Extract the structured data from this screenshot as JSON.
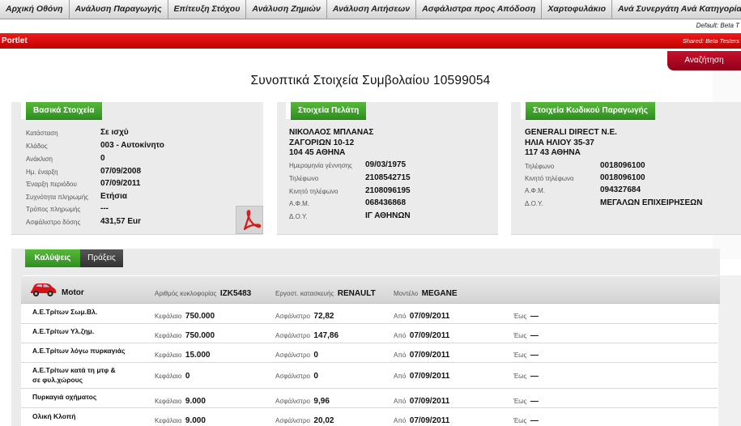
{
  "nav": {
    "tabs": [
      "Αρχική Οθόνη",
      "Ανάλυση Παραγωγής",
      "Επίτευξη Στόχου",
      "Ανάλυση Ζημιών",
      "Ανάλυση Αιτήσεων",
      "Ασφάλιστρα προς Απόδοση",
      "Χαρτοφυλάκιο",
      "Ανά Συνεργάτη Ανά Κατηγορία Προϊό"
    ],
    "default_text": "Default: Beta T"
  },
  "portlet": {
    "title": "Portlet",
    "shared": "Shared: Beta Testers",
    "search_label": "Αναζήτηση"
  },
  "page_title": "Συνοπτικά Στοιχεία Συμβολαίου 10599054",
  "basic": {
    "tab_label": "Βασικά Στοιχεία",
    "rows": [
      {
        "label": "Κατάσταση",
        "value": "Σε ισχύ"
      },
      {
        "label": "Κλάδος",
        "value": "003 - Αυτοκίνητο"
      },
      {
        "label": "Ανάκλιση",
        "value": "0"
      },
      {
        "label": "Ημ. έναρξη",
        "value": "07/09/2008"
      },
      {
        "label": "Έναρξη περιόδου",
        "value": "07/09/2011"
      },
      {
        "label": "Συχνότητα πληρωμής",
        "value": "Ετήσια"
      },
      {
        "label": "Τρόπος πληρωμής",
        "value": "---"
      },
      {
        "label": "Ασφάλιστρο δόσης",
        "value": "431,57 Eur"
      }
    ]
  },
  "client": {
    "tab_label": "Στοιχεία Πελάτη",
    "name": "ΝΙΚΟΛΑΟΣ ΜΠΛΑΝΑΣ",
    "address1": "ΖΑΓΟΡΙΩΝ 10-12",
    "address2": "104 45 ΑΘΗΝΑ",
    "rows": [
      {
        "label": "Ημερομηνία γέννησης",
        "value": "09/03/1975"
      },
      {
        "label": "Τηλέφωνο",
        "value": "2108542715"
      },
      {
        "label": "Κινητό τηλέφωνο",
        "value": "2108096195"
      },
      {
        "label": "Α.Φ.Μ.",
        "value": "068436868"
      },
      {
        "label": "Δ.Ο.Υ.",
        "value": "ΙΓ ΑΘΗΝΩΝ"
      }
    ]
  },
  "producer": {
    "tab_label": "Στοιχεία Κωδικού Παραγωγής",
    "name": "GENERALI DIRECT Ν.Ε.",
    "address1": "ΗΛΙΑ ΗΛΙΟΥ 35-37",
    "address2": "117 43 ΑΘΗΝΑ",
    "rows": [
      {
        "label": "Τηλέφωνο",
        "value": "0018096100"
      },
      {
        "label": "Κινητό τηλέφωνο",
        "value": "0018096100"
      },
      {
        "label": "Α.Φ.Μ.",
        "value": "094327684"
      },
      {
        "label": "Δ.Ο.Υ.",
        "value": "ΜΕΓΑΛΩΝ ΕΠΙΧΕΙΡΗΣΕΩΝ"
      }
    ]
  },
  "coverage": {
    "tabs": {
      "active": "Καλύψεις",
      "inactive": "Πράξεις"
    },
    "motor": {
      "title": "Motor",
      "plate_label": "Αριθμός κυκλοφορίας",
      "plate": "IZK5483",
      "maker_label": "Εργοστ. κατασκευής",
      "maker": "RENAULT",
      "model_label": "Μοντέλο",
      "model": "MEGANE"
    },
    "labels": {
      "capital": "Κεφάλαιο",
      "premium": "Ασφάλιστρο",
      "from": "Από",
      "to": "Έως"
    },
    "rows": [
      {
        "name1": "Α.Ε.Τρίτων Σωμ.Βλ.",
        "name2": "",
        "capital": "750.000",
        "premium": "72,82",
        "from": "07/09/2011",
        "to": "—"
      },
      {
        "name1": "Α.Ε.Τρίτων Υλ.ζημ.",
        "name2": "",
        "capital": "750.000",
        "premium": "147,86",
        "from": "07/09/2011",
        "to": "—"
      },
      {
        "name1": "Α.Ε.Τρίτων λόγω πυρκαγιάς",
        "name2": "",
        "capital": "15.000",
        "premium": "0",
        "from": "07/09/2011",
        "to": "—"
      },
      {
        "name1": "Α.Ε.Τρίτων κατά τη μτφ &",
        "name2": "σε φυλ.χώρους",
        "capital": "0",
        "premium": "0",
        "from": "07/09/2011",
        "to": "—"
      },
      {
        "name1": "Πυρκαγιά οχήματος",
        "name2": "",
        "capital": "9.000",
        "premium": "9,96",
        "from": "07/09/2011",
        "to": "—"
      },
      {
        "name1": "Ολική Κλοπή",
        "name2": "",
        "capital": "9.000",
        "premium": "20,02",
        "from": "07/09/2011",
        "to": "—"
      }
    ]
  },
  "icons": {
    "pdf": "pdf-icon",
    "car": "car-icon"
  },
  "colors": {
    "nav_bg": "#d4d4d4",
    "portlet_red": "#d40000",
    "tab_green": "#3f9f2a",
    "panel_gray": "#ebebeb"
  }
}
